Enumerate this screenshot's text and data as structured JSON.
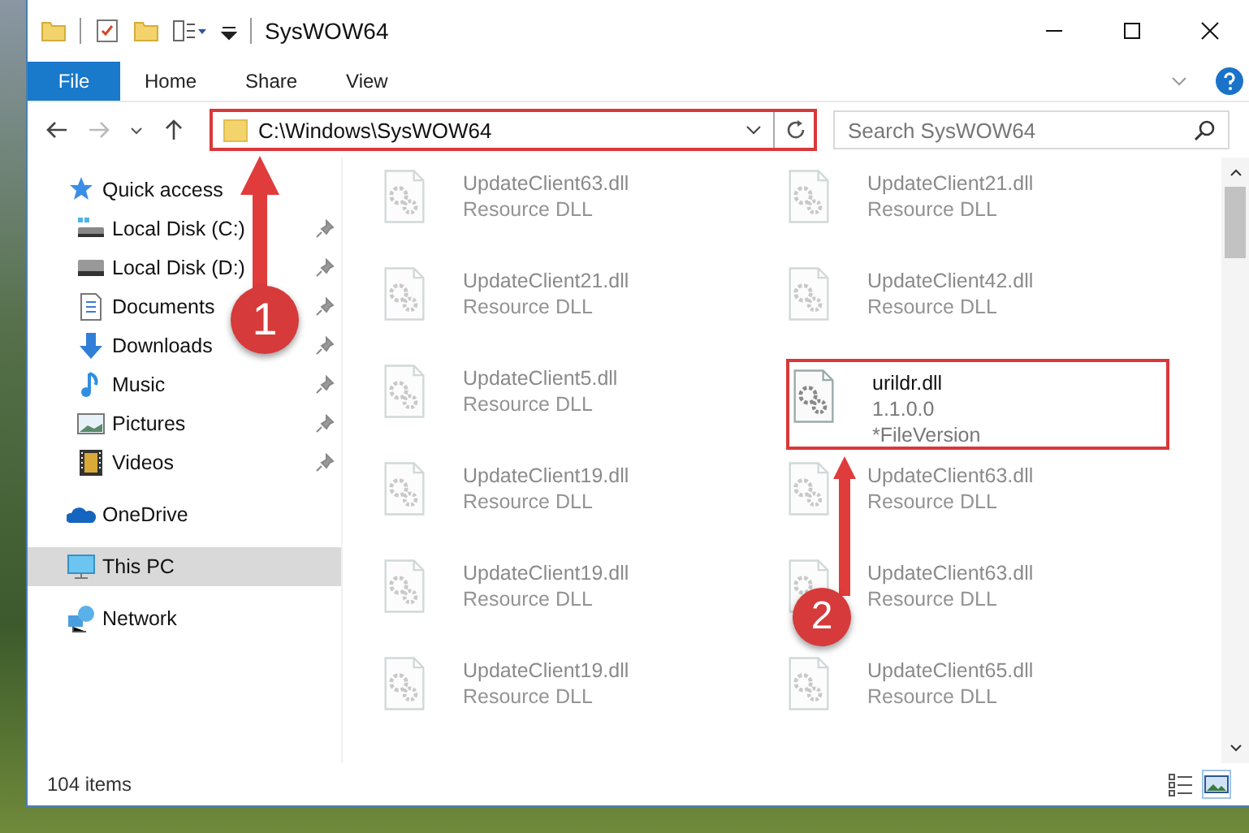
{
  "window": {
    "title": "SysWOW64"
  },
  "ribbon_tabs": [
    {
      "label": "File",
      "kind": "file",
      "selected": false
    },
    {
      "label": "Home",
      "kind": "tab",
      "selected": false
    },
    {
      "label": "Share",
      "kind": "tab",
      "selected": false
    },
    {
      "label": "View",
      "kind": "tab",
      "selected": false
    }
  ],
  "address_bar": {
    "path": "C:\\Windows\\SysWOW64",
    "highlighted": true
  },
  "search": {
    "placeholder": "Search SysWOW64"
  },
  "sidebar": {
    "items": [
      {
        "label": "Quick access",
        "selected": false,
        "children": [
          {
            "label": "Local Disk (C:)",
            "pinned": true,
            "selected": false
          },
          {
            "label": "Local Disk (D:)",
            "pinned": true,
            "selected": false
          },
          {
            "label": "Documents",
            "pinned": true,
            "selected": false
          },
          {
            "label": "Downloads",
            "pinned": true,
            "selected": false
          },
          {
            "label": "Music",
            "pinned": true,
            "selected": false
          },
          {
            "label": "Pictures",
            "pinned": true,
            "selected": false
          },
          {
            "label": "Videos",
            "pinned": true,
            "selected": false
          }
        ]
      },
      {
        "label": "OneDrive",
        "selected": false
      },
      {
        "label": "This PC",
        "selected": true
      },
      {
        "label": "Network",
        "selected": false
      }
    ]
  },
  "files": [
    {
      "name": "UpdateClient63.dll",
      "lines": [
        "Resource DLL"
      ],
      "faded": true,
      "highlighted": false
    },
    {
      "name": "UpdateClient21.dll",
      "lines": [
        "Resource DLL"
      ],
      "faded": true,
      "highlighted": false
    },
    {
      "name": "UpdateClient21.dll",
      "lines": [
        "Resource DLL"
      ],
      "faded": true,
      "highlighted": false
    },
    {
      "name": "UpdateClient42.dll",
      "lines": [
        "Resource DLL"
      ],
      "faded": true,
      "highlighted": false
    },
    {
      "name": "UpdateClient5.dll",
      "lines": [
        "Resource DLL"
      ],
      "faded": true,
      "highlighted": false
    },
    {
      "name": "urildr.dll",
      "lines": [
        "1.1.0.0",
        "*FileVersion"
      ],
      "faded": false,
      "highlighted": true
    },
    {
      "name": "UpdateClient19.dll",
      "lines": [
        "Resource DLL"
      ],
      "faded": true,
      "highlighted": false
    },
    {
      "name": "UpdateClient63.dll",
      "lines": [
        "Resource DLL"
      ],
      "faded": true,
      "highlighted": false
    },
    {
      "name": "UpdateClient19.dll",
      "lines": [
        "Resource DLL"
      ],
      "faded": true,
      "highlighted": false
    },
    {
      "name": "UpdateClient63.dll",
      "lines": [
        "Resource DLL"
      ],
      "faded": true,
      "highlighted": false
    },
    {
      "name": "UpdateClient19.dll",
      "lines": [
        "Resource DLL"
      ],
      "faded": true,
      "highlighted": false
    },
    {
      "name": "UpdateClient65.dll",
      "lines": [
        "Resource DLL"
      ],
      "faded": true,
      "highlighted": false
    }
  ],
  "status_bar": {
    "item_count": "104 items"
  },
  "annotations": [
    {
      "label": "1"
    },
    {
      "label": "2"
    }
  ]
}
